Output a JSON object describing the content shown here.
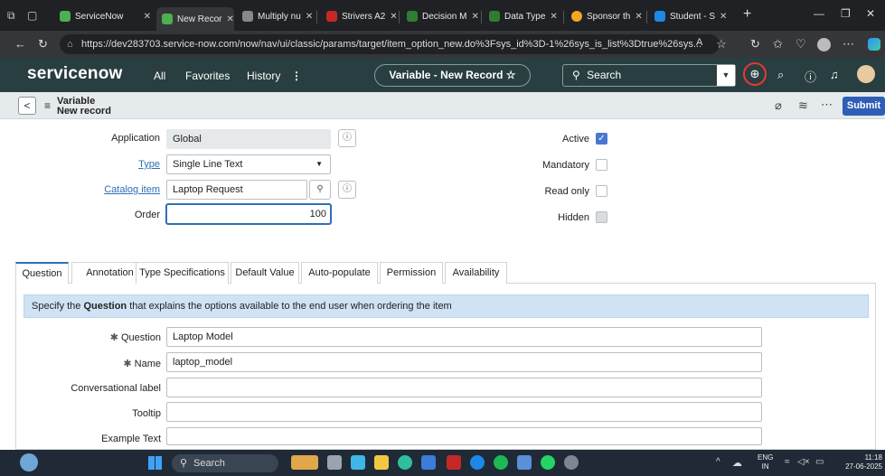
{
  "browser": {
    "tabs": [
      {
        "label": "ServiceNow",
        "color": "#4caf50"
      },
      {
        "label": "New Recor",
        "color": "#4caf50"
      },
      {
        "label": "Multiply nu",
        "color": "#888888"
      },
      {
        "label": "Strivers A2",
        "color": "#c62828"
      },
      {
        "label": "Decision M",
        "color": "#2e7d32"
      },
      {
        "label": "Data Type",
        "color": "#2e7d32"
      },
      {
        "label": "Sponsor th",
        "color": "#f5a623"
      },
      {
        "label": "Student - S",
        "color": "#1e88e5"
      }
    ],
    "url": "https://dev283703.service-now.com/now/nav/ui/classic/params/target/item_option_new.do%3Fsys_id%3D-1%26sys_is_list%3Dtrue%26sys..."
  },
  "header": {
    "logo": "servicenow",
    "nav": [
      "All",
      "Favorites",
      "History"
    ],
    "record_pill": "Variable - New Record ☆",
    "search_placeholder": "Search"
  },
  "formbar": {
    "title": "Variable",
    "subtitle": "New record",
    "submit": "Submit"
  },
  "form": {
    "application": {
      "label": "Application",
      "value": "Global"
    },
    "type": {
      "label": "Type",
      "value": "Single Line Text"
    },
    "catalog_item": {
      "label": "Catalog item",
      "value": "Laptop Request"
    },
    "order": {
      "label": "Order",
      "value": "100"
    },
    "active": {
      "label": "Active",
      "checked": true
    },
    "mandatory": {
      "label": "Mandatory",
      "checked": false
    },
    "read_only": {
      "label": "Read only",
      "checked": false
    },
    "hidden": {
      "label": "Hidden",
      "checked": false
    }
  },
  "tabs": [
    "Question",
    "Annotation",
    "Type Specifications",
    "Default Value",
    "Auto-populate",
    "Permission",
    "Availability"
  ],
  "question_tab": {
    "note_pre": "Specify the ",
    "note_bold": "Question",
    "note_post": " that explains the options available to the end user when ordering the item",
    "question": {
      "label": "Question",
      "value": "Laptop Model"
    },
    "name": {
      "label": "Name",
      "value": "laptop_model"
    },
    "conversational_label": {
      "label": "Conversational label",
      "value": ""
    },
    "tooltip": {
      "label": "Tooltip",
      "value": ""
    },
    "example_text": {
      "label": "Example Text",
      "value": ""
    }
  },
  "taskbar": {
    "search": "Search",
    "lang": "ENG",
    "region": "IN",
    "time": "11:18",
    "date": "27-06-2025"
  }
}
